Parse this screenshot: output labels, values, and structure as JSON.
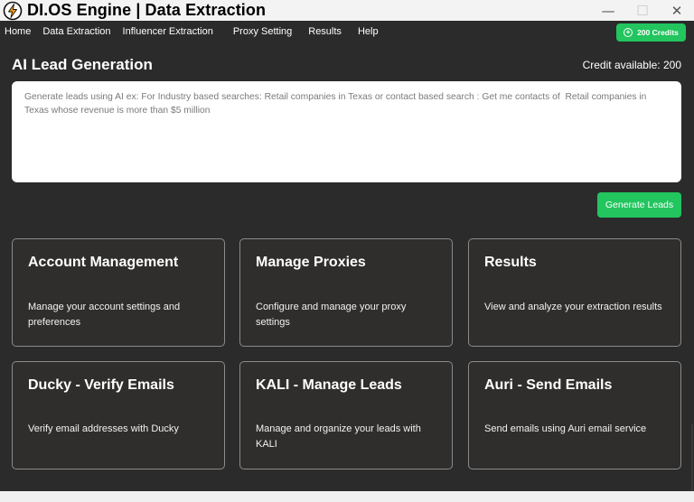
{
  "window": {
    "title": "DI.OS Engine | Data Extraction",
    "controls": {
      "minimize": "—",
      "maximize": "☐",
      "close": "✕"
    }
  },
  "menu": {
    "items": [
      "Home",
      "Data Extraction",
      "Influencer Extraction",
      "Proxy Setting",
      "Results",
      "Help"
    ],
    "credits_button": "200 Credits"
  },
  "main": {
    "title": "AI Lead Generation",
    "credit_available": "Credit available: 200",
    "prompt_placeholder": "Generate leads using AI ex: For Industry based searches: Retail companies in Texas or contact based search : Get me contacts of  Retail companies in Texas whose revenue is more than $5 million",
    "generate_button": "Generate Leads"
  },
  "cards": [
    {
      "title": "Account Management",
      "description": "Manage your account settings and preferences"
    },
    {
      "title": "Manage Proxies",
      "description": "Configure and manage your proxy settings"
    },
    {
      "title": "Results",
      "description": "View and analyze your extraction results"
    },
    {
      "title": "Ducky - Verify Emails",
      "description": "Verify email addresses with Ducky"
    },
    {
      "title": "KALI - Manage Leads",
      "description": "Manage and organize your leads with KALI"
    },
    {
      "title": "Auri - Send Emails",
      "description": "Send emails using Auri email service"
    }
  ],
  "colors": {
    "accent": "#22c55e",
    "background": "#2b2b2b",
    "card": "#2f2e2c"
  }
}
